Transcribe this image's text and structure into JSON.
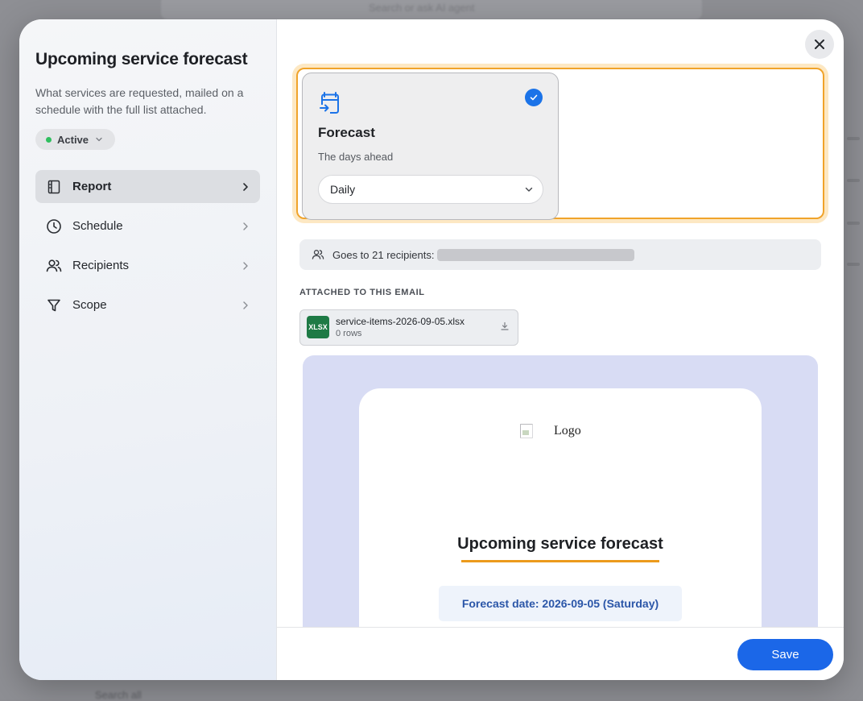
{
  "background": {
    "search_placeholder": "Search or ask AI agent",
    "bottom_text": "Search all"
  },
  "sidebar": {
    "title": "Upcoming service forecast",
    "description": "What services are requested, mailed on a schedule with the full list attached.",
    "status": {
      "label": "Active",
      "color": "#2fbf5f"
    },
    "items": [
      {
        "label": "Report",
        "icon": "report-icon",
        "active": true
      },
      {
        "label": "Schedule",
        "icon": "clock-icon",
        "active": false
      },
      {
        "label": "Recipients",
        "icon": "users-icon",
        "active": false
      },
      {
        "label": "Scope",
        "icon": "filter-icon",
        "active": false
      }
    ]
  },
  "report_card": {
    "icon": "calendar-arrow-icon",
    "title": "Forecast",
    "subtitle": "The days ahead",
    "selected": true,
    "frequency": "Daily"
  },
  "recipients": {
    "text": "Goes to 21 recipients:"
  },
  "attachments": {
    "heading": "ATTACHED TO THIS EMAIL",
    "file": {
      "badge": "XLSX",
      "name": "service-items-2026-09-05.xlsx",
      "rows": "0 rows"
    }
  },
  "email_preview": {
    "logo_alt": "Logo",
    "title": "Upcoming service forecast",
    "date_line": "Forecast date: 2026-09-05 (Saturday)"
  },
  "footer": {
    "save_label": "Save"
  },
  "colors": {
    "accent": "#1b67e8",
    "highlight": "#f0a32a",
    "preview_bg": "#d8dcf4"
  }
}
